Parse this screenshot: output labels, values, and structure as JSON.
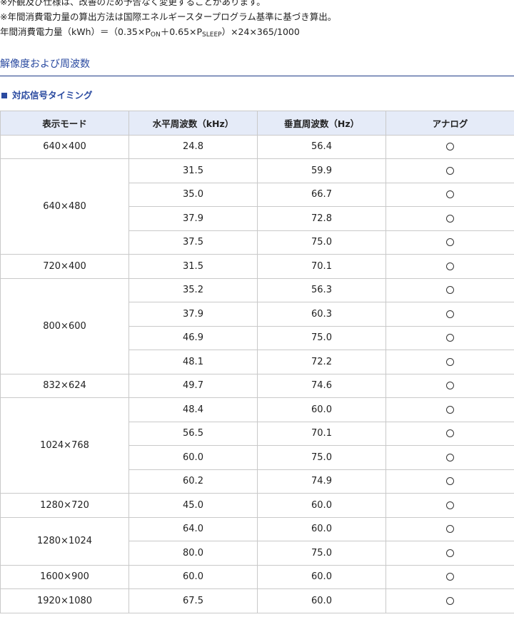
{
  "notes": [
    "※外観及び仕様は、改善のため予告なく変更することがあります。",
    "※年間消費電力量の算出方法は国際エネルギースタープログラム基準に基づき算出。"
  ],
  "formula": {
    "prefix": "年間消費電力量（kWh）＝（0.35×P",
    "sub_on": "ON",
    "middle": "＋0.65×P",
    "sub_sleep": "SLEEP",
    "suffix": "）×24×365/1000"
  },
  "section_title": "解像度および周波数",
  "subsection_title": "対応信号タイミング",
  "table": {
    "headers": [
      "表示モード",
      "水平周波数（kHz）",
      "垂直周波数（Hz）",
      "アナログ"
    ],
    "groups": [
      {
        "mode": "640×400",
        "rows": [
          [
            "24.8",
            "56.4"
          ]
        ]
      },
      {
        "mode": "640×480",
        "rows": [
          [
            "31.5",
            "59.9"
          ],
          [
            "35.0",
            "66.7"
          ],
          [
            "37.9",
            "72.8"
          ],
          [
            "37.5",
            "75.0"
          ]
        ]
      },
      {
        "mode": "720×400",
        "rows": [
          [
            "31.5",
            "70.1"
          ]
        ]
      },
      {
        "mode": "800×600",
        "rows": [
          [
            "35.2",
            "56.3"
          ],
          [
            "37.9",
            "60.3"
          ],
          [
            "46.9",
            "75.0"
          ],
          [
            "48.1",
            "72.2"
          ]
        ]
      },
      {
        "mode": "832×624",
        "rows": [
          [
            "49.7",
            "74.6"
          ]
        ]
      },
      {
        "mode": "1024×768",
        "rows": [
          [
            "48.4",
            "60.0"
          ],
          [
            "56.5",
            "70.1"
          ],
          [
            "60.0",
            "75.0"
          ],
          [
            "60.2",
            "74.9"
          ]
        ]
      },
      {
        "mode": "1280×720",
        "rows": [
          [
            "45.0",
            "60.0"
          ]
        ]
      },
      {
        "mode": "1280×1024",
        "rows": [
          [
            "64.0",
            "60.0"
          ],
          [
            "80.0",
            "75.0"
          ]
        ]
      },
      {
        "mode": "1600×900",
        "rows": [
          [
            "60.0",
            "60.0"
          ]
        ]
      },
      {
        "mode": "1920×1080",
        "rows": [
          [
            "67.5",
            "60.0"
          ]
        ]
      }
    ],
    "analog_supported_icon": "circle-icon"
  }
}
